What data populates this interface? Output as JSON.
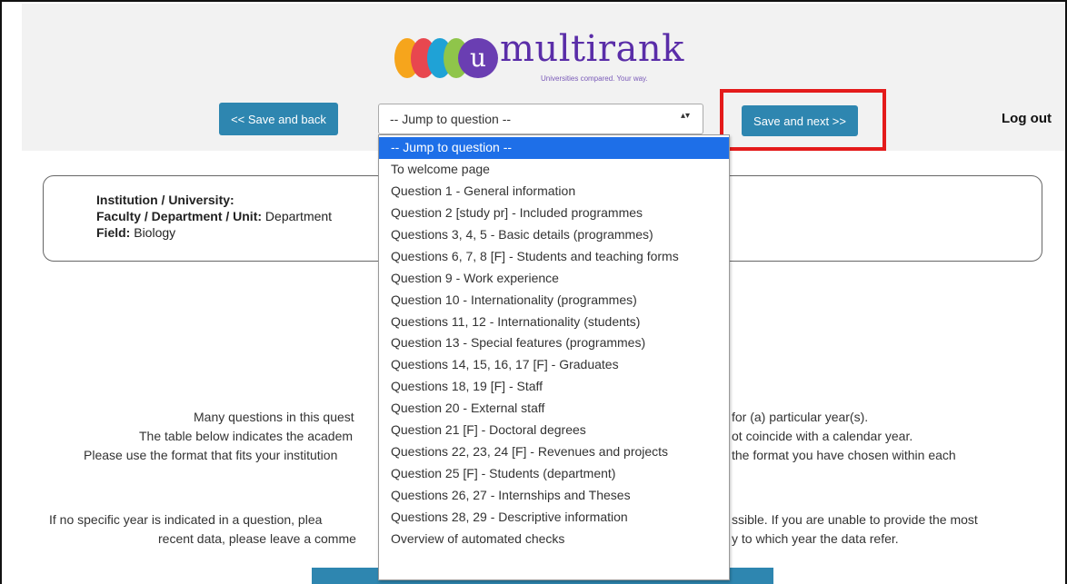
{
  "logo": {
    "brand": "multirank",
    "tagline": "Universities compared. Your way.",
    "letter": "u",
    "colors": [
      "#f6a51c",
      "#e8474f",
      "#1fa2d6",
      "#8fc54a",
      "#6a3eb2"
    ]
  },
  "nav": {
    "back_label": "<< Save and back",
    "next_label": "Save and next >>",
    "logout_label": "Log out"
  },
  "select": {
    "current": "-- Jump to question --",
    "arrows": "▴▾"
  },
  "dropdown": {
    "options": [
      "-- Jump to question --",
      "To welcome page",
      "Question 1 - General information",
      "Question 2 [study pr] - Included programmes",
      "Questions 3, 4, 5 - Basic details (programmes)",
      "Questions 6, 7, 8 [F] - Students and teaching forms",
      "Question 9 - Work experience",
      "Question 10 - Internationality (programmes)",
      "Questions 11, 12 - Internationality (students)",
      "Question 13 - Special features (programmes)",
      "Questions 14, 15, 16, 17 [F] - Graduates",
      "Questions 18, 19 [F] - Staff",
      "Question 20 - External staff",
      "Question 21 [F] - Doctoral degrees",
      "Questions 22, 23, 24 [F] - Revenues and projects",
      "Question 25 [F] - Students (department)",
      "Questions 26, 27 - Internships and Theses",
      "Questions 28, 29 - Descriptive information",
      "Overview of automated checks"
    ]
  },
  "info": {
    "institution_label": "Institution / University:",
    "faculty_label": "Faculty / Department / Unit:",
    "faculty_value": "Department",
    "field_label": "Field:",
    "field_value": "Biology"
  },
  "body_text": {
    "p1_left": "Many questions in this quest",
    "p1_right": "for (a) particular year(s).",
    "p2_left": "The table below indicates the academ",
    "p2_right": "ot coincide with a calendar year.",
    "p3_left": "Please use the format that fits your institution",
    "p3_right": "the format you have chosen within each",
    "p4_left": "If no specific year is indicated in a question, plea",
    "p4_right": "ssible. If you are unable to provide the most",
    "p5_left": "recent data, please leave a comme",
    "p5_right": "y to which year the data refer."
  }
}
